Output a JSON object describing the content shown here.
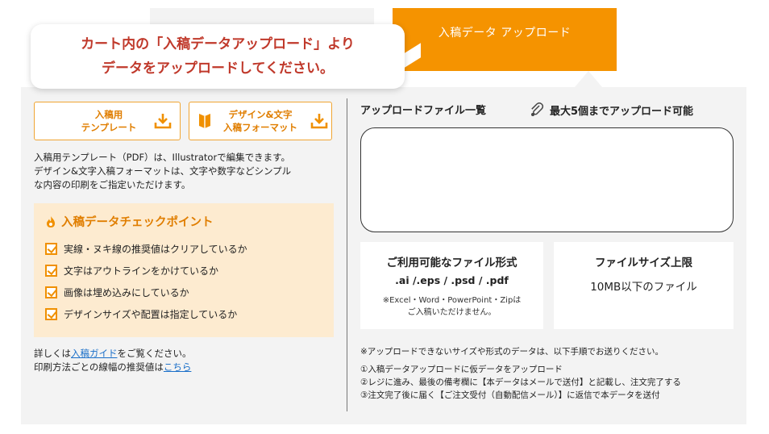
{
  "tabs": {
    "active_label": "入稿データ アップロード"
  },
  "callout": {
    "line1": "カート内の「入稿データアップロード」より",
    "line2": "データをアップロードしてください。"
  },
  "left": {
    "template_button": {
      "line1": "入稿用",
      "line2": "テンプレート"
    },
    "format_button": {
      "line1": "デザイン&文字",
      "line2": "入稿フォーマット"
    },
    "description": [
      "入稿用テンプレート（PDF）は、Illustratorで編集できます。",
      "デザイン&文字入稿フォーマットは、文字や数字などシンプル",
      "な内容の印刷をご指定いただけます。"
    ],
    "checkpoint": {
      "title": "入稿データチェックポイント",
      "items": [
        "実線・ヌキ線の推奨値はクリアしているか",
        "文字はアウトラインをかけているか",
        "画像は埋め込みにしているか",
        "デザインサイズや配置は指定しているか"
      ]
    },
    "more": {
      "line1_prefix": "詳しくは",
      "line1_link": "入稿ガイド",
      "line1_suffix": "をご覧ください。",
      "line2_prefix": "印刷方法ごとの線幅の推奨値は",
      "line2_link": "こちら"
    }
  },
  "right": {
    "upload_title": "アップロードファイル一覧",
    "upload_max": "最大5個までアップロード可能",
    "formats": {
      "title": "ご利用可能なファイル形式",
      "extensions": ".ai /.eps / .psd / .pdf",
      "note_line1": "※Excel・Word・PowerPoint・Zipは",
      "note_line2": "ご入稿いただけません。"
    },
    "size": {
      "title": "ファイルサイズ上限",
      "value": "10MB以下のファイル"
    },
    "notes": {
      "intro": "※アップロードできないサイズや形式のデータは、以下手順でお送りください。",
      "steps": [
        "①入稿データアップロードに仮データをアップロード",
        "②レジに進み、最後の備考欄に【本データはメールで送付】と記載し、注文完了する",
        "③注文完了後に届く【ご注文受付（自動配信メール）】に返信で本データを送付"
      ]
    }
  },
  "colors": {
    "accent": "#f59300",
    "callout_text": "#c0392b",
    "checkpoint_bg": "#fdebd0",
    "link": "#1a6fc9"
  },
  "icons": [
    "download-icon",
    "book-icon",
    "fire-icon",
    "checkbox-icon",
    "paperclip-icon"
  ]
}
